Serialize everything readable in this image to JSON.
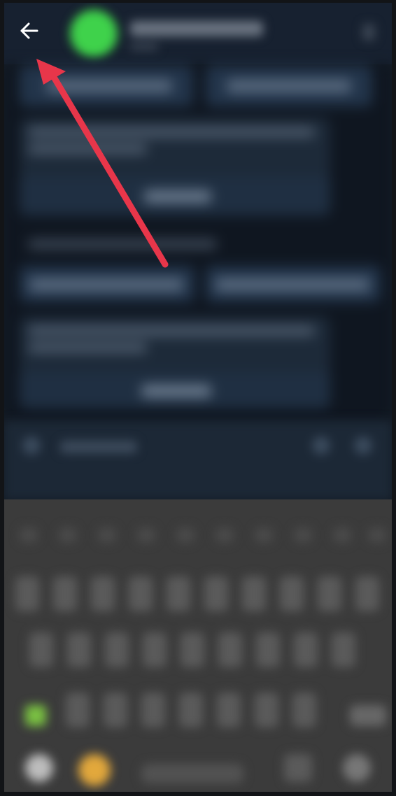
{
  "header": {
    "back_icon": "back-arrow-icon",
    "avatar_color": "#3fd24b"
  },
  "annotation": {
    "type": "arrow",
    "color": "#e8364a",
    "points_to": "back-arrow-icon"
  },
  "colors": {
    "background": "#141c26",
    "header": "#172130",
    "keyboard": "#3b3b3b",
    "accent_green": "#7ac142",
    "emoji": "#e2a83c"
  }
}
